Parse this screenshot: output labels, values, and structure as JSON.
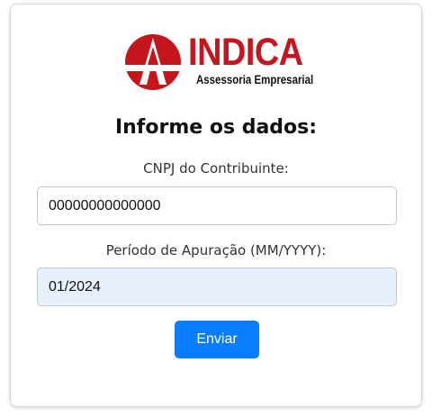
{
  "logo": {
    "brand": "INDICA",
    "tagline": "Assessoria Empresarial",
    "icon": "indica-logo-mark-icon",
    "colors": {
      "red": "#c4161c",
      "dark": "#111111"
    }
  },
  "form": {
    "title": "Informe os dados:",
    "cnpj": {
      "label": "CNPJ do Contribuinte:",
      "value": "00000000000000"
    },
    "periodo": {
      "label": "Período de Apuração (MM/YYYY):",
      "value": "01/2024",
      "autofill_bg": "#e8f0fe"
    },
    "submit_label": "Enviar",
    "submit_color": "#0a7cff"
  }
}
